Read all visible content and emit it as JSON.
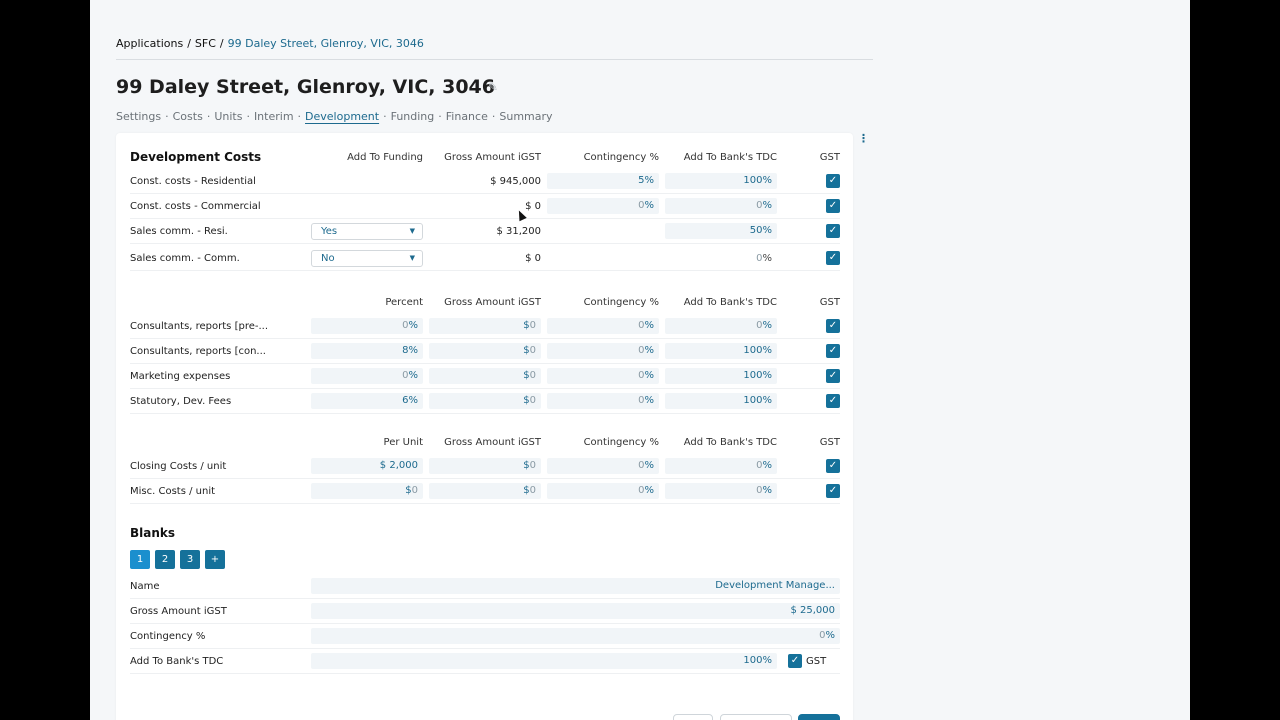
{
  "breadcrumb": {
    "items": [
      "Applications",
      "SFC"
    ],
    "current": "99 Daley Street, Glenroy, VIC, 3046"
  },
  "title": "99 Daley Street, Glenroy, VIC, 3046",
  "nav": {
    "tabs": [
      "Settings",
      "Costs",
      "Units",
      "Interim",
      "Development",
      "Funding",
      "Finance",
      "Summary"
    ],
    "active": "Development"
  },
  "dev_costs": {
    "title": "Development Costs",
    "headers": [
      "Add To Funding",
      "Gross Amount iGST",
      "Contingency %",
      "Add To Bank's TDC",
      "GST"
    ],
    "rows": [
      {
        "label": "Const. costs - Residential",
        "gross": "$ 945,000",
        "cont_num": "5",
        "cont_unit": "%",
        "tdc_num": "100",
        "tdc_unit": "%"
      },
      {
        "label": "Const. costs - Commercial",
        "gross": "$ 0",
        "cont_num": "0",
        "cont_unit": "%",
        "tdc_num": "0",
        "tdc_unit": "%"
      },
      {
        "label": "Sales comm. - Resi.",
        "funding": "Yes",
        "gross": "$ 31,200",
        "tdc_num": "50",
        "tdc_unit": "%"
      },
      {
        "label": "Sales comm. - Comm.",
        "funding": "No",
        "gross": "$ 0",
        "tdc_num": "0",
        "tdc_unit": "%"
      }
    ]
  },
  "percent_costs": {
    "headers": [
      "Percent",
      "Gross Amount iGST",
      "Contingency %",
      "Add To Bank's TDC",
      "GST"
    ],
    "rows": [
      {
        "label": "Consultants, reports [pre-...",
        "pct_num": "0",
        "pct_unit": "%",
        "gross_cur": "$",
        "gross_num": "0",
        "cont_num": "0",
        "cont_unit": "%",
        "tdc_num": "0",
        "tdc_unit": "%"
      },
      {
        "label": "Consultants, reports [con...",
        "pct_num": "8",
        "pct_unit": "%",
        "gross_cur": "$",
        "gross_num": "0",
        "cont_num": "0",
        "cont_unit": "%",
        "tdc_num": "100",
        "tdc_unit": "%"
      },
      {
        "label": "Marketing expenses",
        "pct_num": "0",
        "pct_unit": "%",
        "gross_cur": "$",
        "gross_num": "0",
        "cont_num": "0",
        "cont_unit": "%",
        "tdc_num": "100",
        "tdc_unit": "%"
      },
      {
        "label": "Statutory, Dev. Fees",
        "pct_num": "6",
        "pct_unit": "%",
        "gross_cur": "$",
        "gross_num": "0",
        "cont_num": "0",
        "cont_unit": "%",
        "tdc_num": "100",
        "tdc_unit": "%"
      }
    ]
  },
  "unit_costs": {
    "headers": [
      "Per Unit",
      "Gross Amount iGST",
      "Contingency %",
      "Add To Bank's TDC",
      "GST"
    ],
    "rows": [
      {
        "label": "Closing Costs / unit",
        "unit_cur": "$",
        "unit_num": "2,000",
        "gross_cur": "$",
        "gross_num": "0",
        "cont_num": "0",
        "cont_unit": "%",
        "tdc_num": "0",
        "tdc_unit": "%"
      },
      {
        "label": "Misc. Costs / unit",
        "unit_cur": "$",
        "unit_num": "0",
        "gross_cur": "$",
        "gross_num": "0",
        "cont_num": "0",
        "cont_unit": "%",
        "tdc_num": "0",
        "tdc_unit": "%"
      }
    ]
  },
  "blanks": {
    "title": "Blanks",
    "pages": [
      "1",
      "2",
      "3",
      "+"
    ],
    "fields": {
      "name_label": "Name",
      "name_value": "Development Manage...",
      "gross_label": "Gross Amount iGST",
      "gross_value": "$ 25,000",
      "cont_label": "Contingency %",
      "cont_num": "0",
      "cont_unit": "%",
      "tdc_label": "Add To Bank's TDC",
      "tdc_num": "100",
      "tdc_unit": "%",
      "gst_label": "GST"
    }
  },
  "icons": {
    "pencil": "pencil-icon",
    "kebab": "kebab-menu-icon",
    "check": "check-icon",
    "caret": "caret-down-icon"
  },
  "colors": {
    "accent": "#15719a",
    "link": "#1d6a8e",
    "active_page": "#1b8fce",
    "input_bg": "#f1f5f8"
  }
}
